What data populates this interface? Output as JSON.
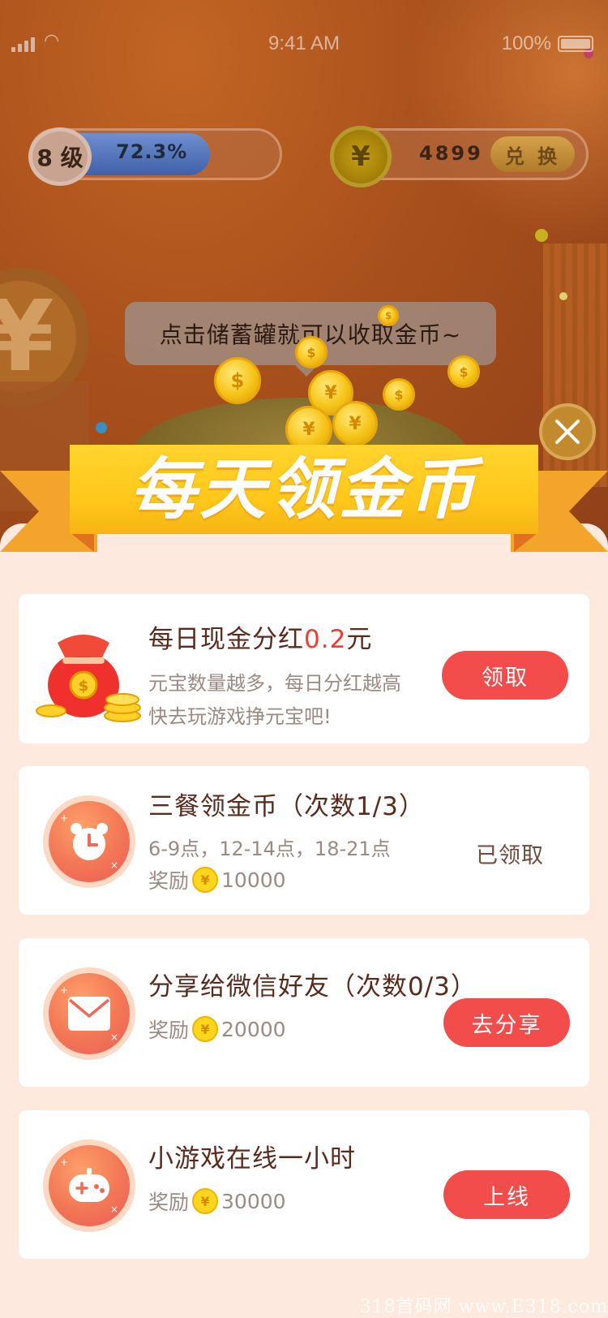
{
  "status_bar": {
    "time": "9:41 AM",
    "battery": "100%"
  },
  "level": {
    "label": "8 级",
    "progress_text": "72.3%",
    "progress": 0.723
  },
  "coins": {
    "symbol": "¥",
    "amount": "4899",
    "exchange_label": "兑 换"
  },
  "tip": "点击储蓄罐就可以收取金币~",
  "banner_title": "每天领金币",
  "tasks": [
    {
      "title_prefix": "每日现金分红",
      "title_highlight": "0.2",
      "title_suffix": "元",
      "line1": "元宝数量越多，每日分红越高",
      "line2": "快去玩游戏挣元宝吧!",
      "button": "领取",
      "icon": "money-bag-icon"
    },
    {
      "title": "三餐领金币（次数1/3）",
      "line1": "6-9点，12-14点，18-21点",
      "reward_label": "奖励",
      "reward_amount": "10000",
      "status": "已领取",
      "icon": "alarm-clock-icon"
    },
    {
      "title": "分享给微信好友（次数0/3）",
      "reward_label": "奖励",
      "reward_amount": "20000",
      "button": "去分享",
      "icon": "envelope-icon"
    },
    {
      "title": "小游戏在线一小时",
      "reward_label": "奖励",
      "reward_amount": "30000",
      "button": "上线",
      "icon": "gamepad-icon"
    }
  ],
  "coin_symbol": "¥",
  "watermark": "318首码网 www.E318.com",
  "colors": {
    "accent_red": "#f24d4a",
    "banner_yellow": "#ffc81a",
    "highlight": "#f23b2b"
  }
}
